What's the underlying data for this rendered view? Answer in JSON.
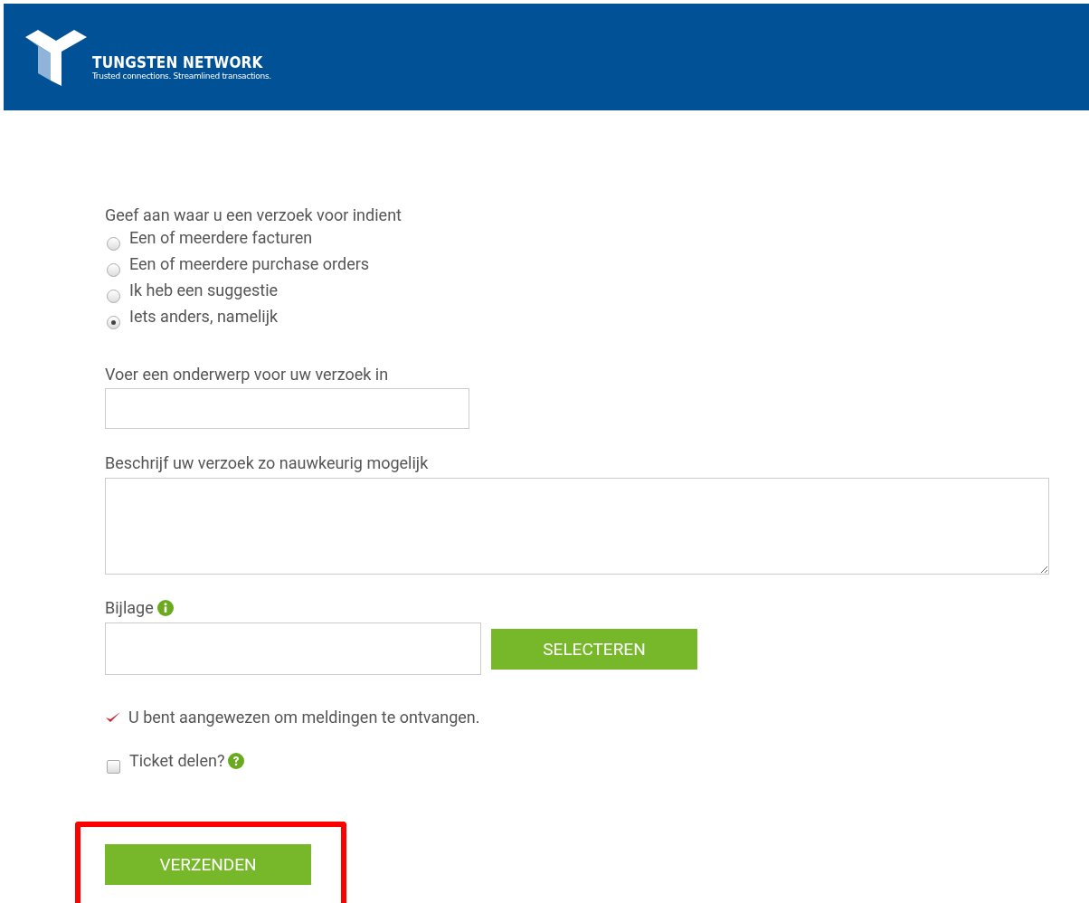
{
  "header": {
    "brand": "TUNGSTEN NETWORK",
    "tagline": "Trusted connections. Streamlined transactions."
  },
  "request_type": {
    "label": "Geef aan waar u een verzoek voor indient",
    "options": [
      {
        "label": "Een of meerdere facturen",
        "selected": false
      },
      {
        "label": "Een of meerdere purchase orders",
        "selected": false
      },
      {
        "label": "Ik heb een suggestie",
        "selected": false
      },
      {
        "label": "Iets anders, namelijk",
        "selected": true
      }
    ]
  },
  "subject": {
    "label": "Voer een onderwerp voor uw verzoek in"
  },
  "description": {
    "label": "Beschrijf uw verzoek zo nauwkeurig mogelijk"
  },
  "attachment": {
    "label": "Bijlage",
    "button": "SELECTEREN"
  },
  "notification": {
    "text": "U bent aangewezen om meldingen te ontvangen.",
    "checked": true
  },
  "share": {
    "label": "Ticket delen?",
    "checked": false
  },
  "submit": {
    "label": "VERZENDEN",
    "highlighted": true
  }
}
